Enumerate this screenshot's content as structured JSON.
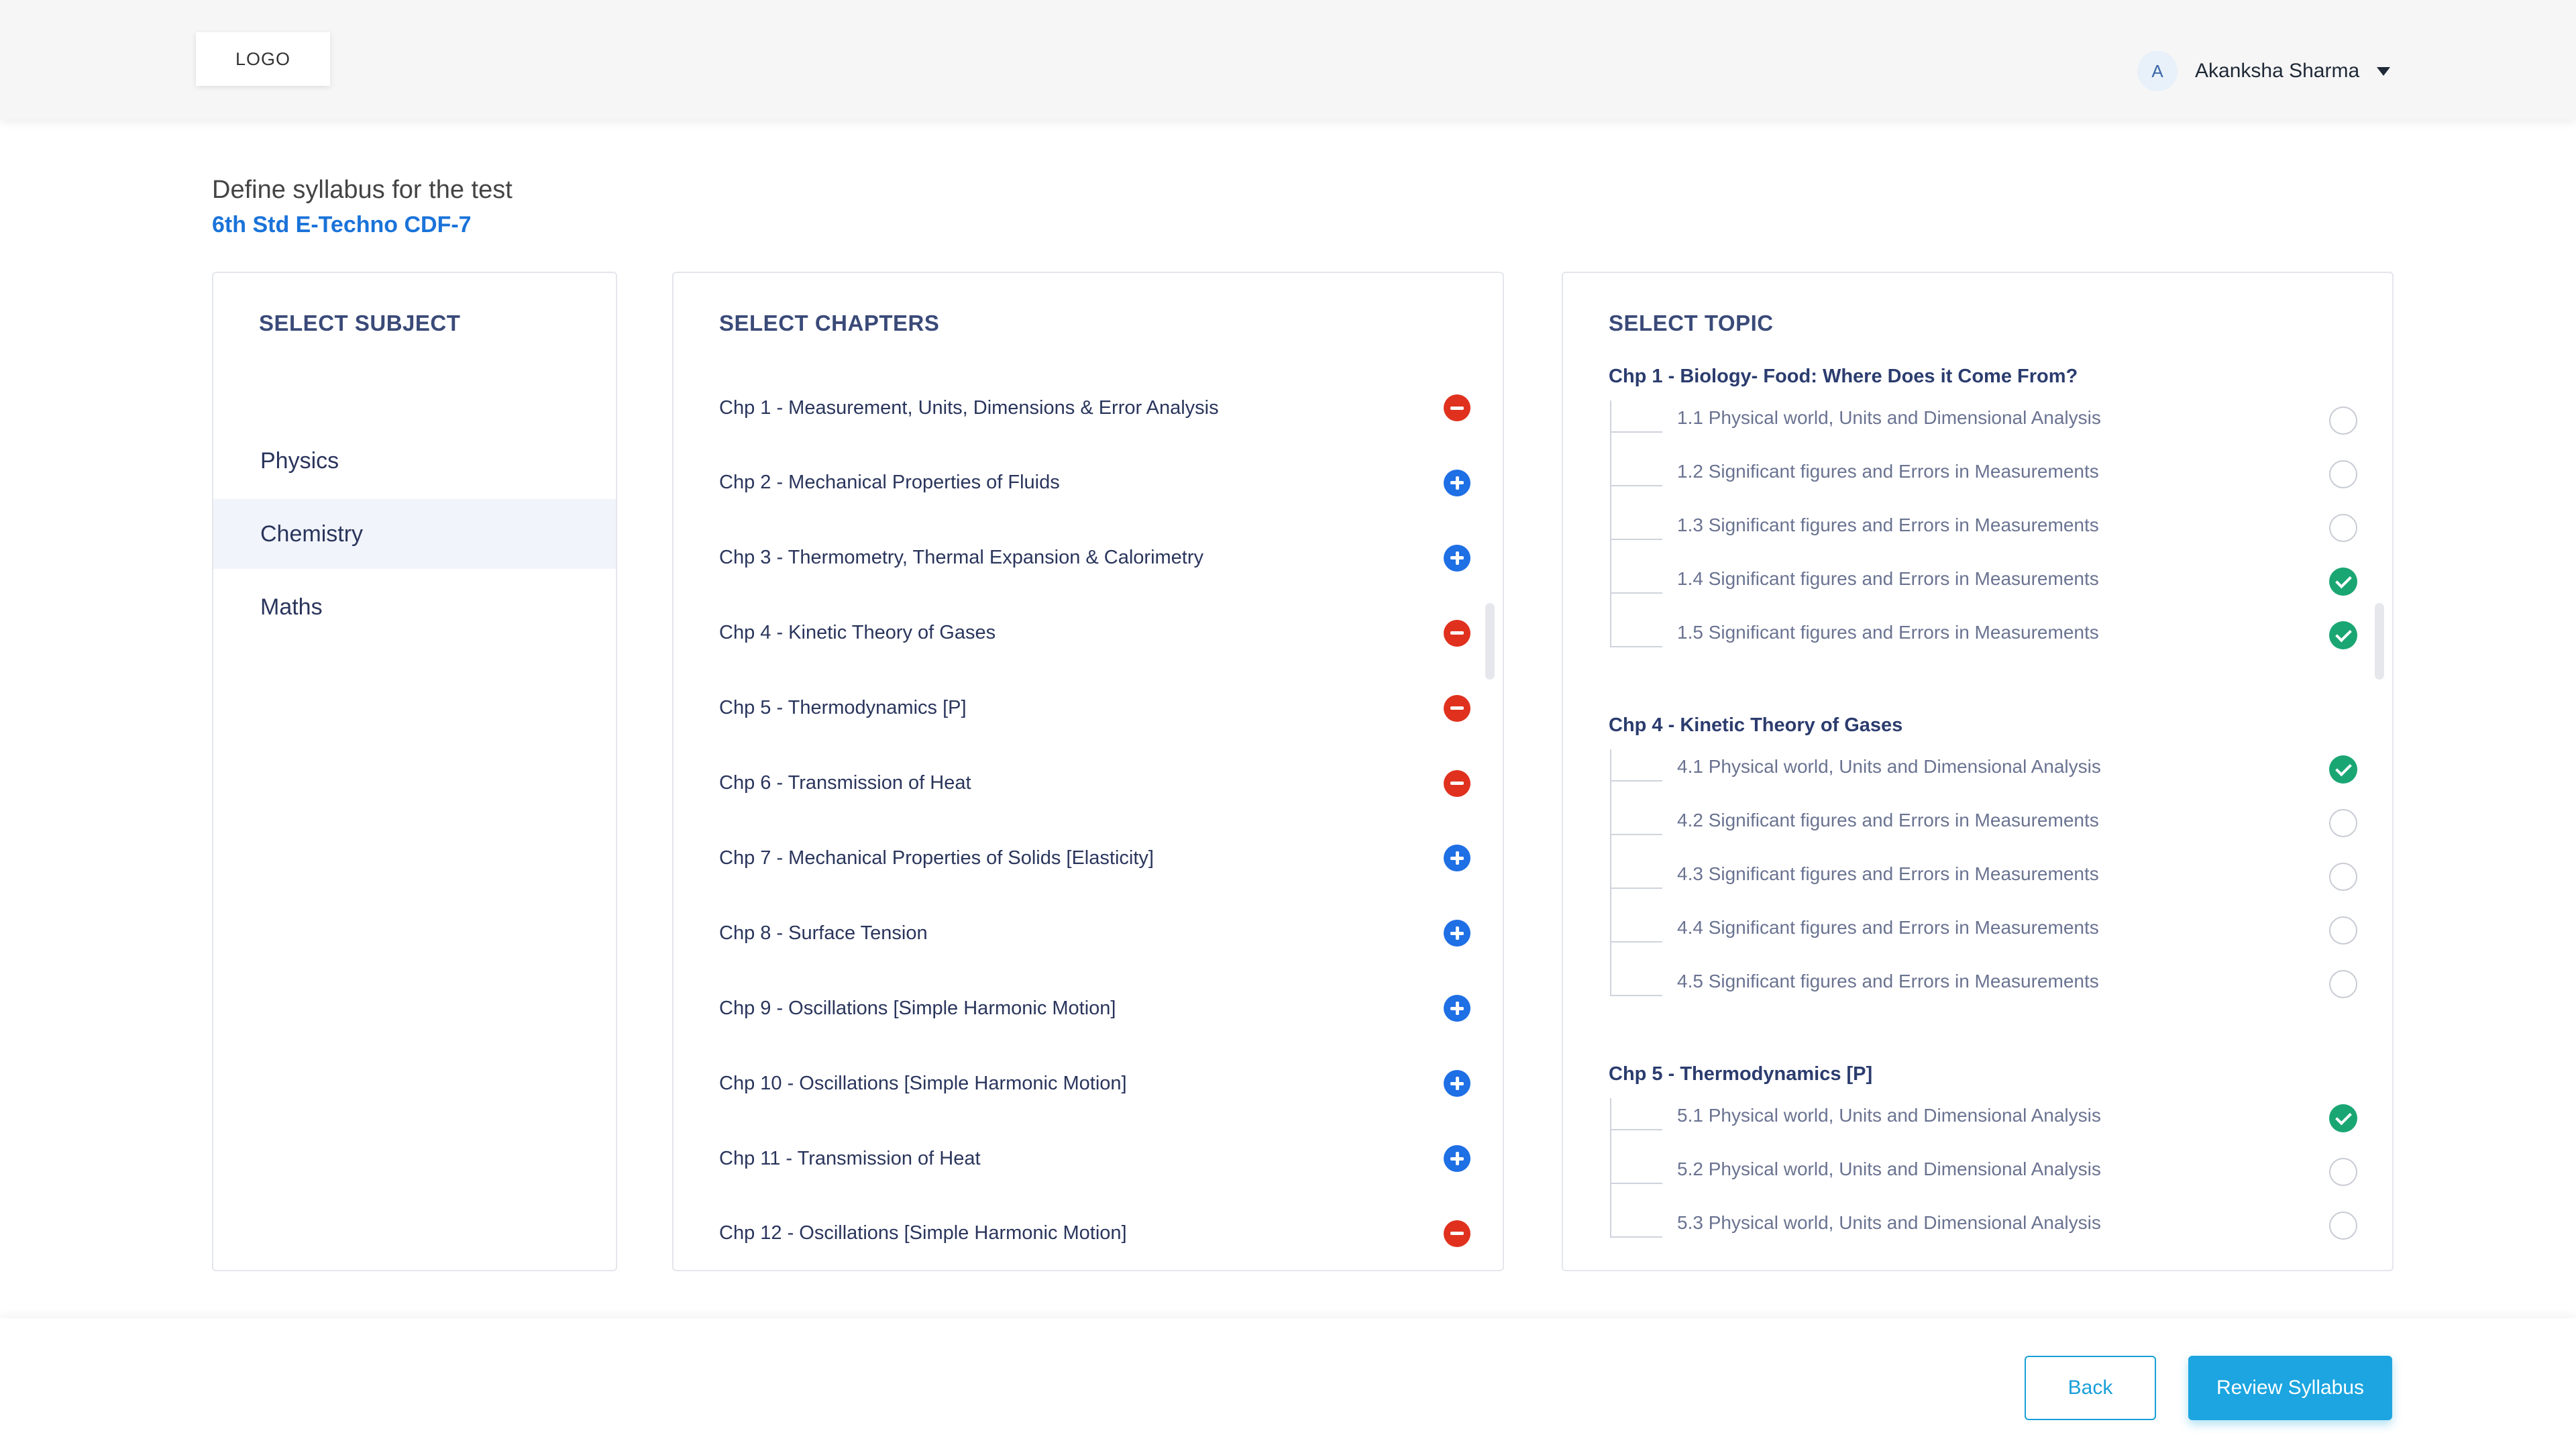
{
  "header": {
    "logo": "LOGO",
    "user": {
      "avatar_initial": "A",
      "name": "Akanksha Sharma"
    }
  },
  "page": {
    "title": "Define syllabus for the test",
    "test_name": "6th Std E-Techno CDF-7"
  },
  "subjects": {
    "title": "SELECT SUBJECT",
    "selected": "Chemistry",
    "items": [
      {
        "label": "Physics",
        "active": false
      },
      {
        "label": "Chemistry",
        "active": true
      },
      {
        "label": "Maths",
        "active": false
      }
    ]
  },
  "chapters": {
    "title": "SELECT CHAPTERS",
    "items": [
      {
        "label": "Chp 1 - Measurement, Units, Dimensions & Error Analysis",
        "state": "selected",
        "icon": "remove-icon"
      },
      {
        "label": "Chp 2 - Mechanical Properties of Fluids",
        "state": "unselected",
        "icon": "add-icon"
      },
      {
        "label": "Chp 3 - Thermometry, Thermal Expansion & Calorimetry",
        "state": "unselected",
        "icon": "add-icon"
      },
      {
        "label": "Chp 4 - Kinetic Theory of Gases",
        "state": "selected",
        "icon": "remove-icon"
      },
      {
        "label": "Chp 5 - Thermodynamics [P]",
        "state": "selected",
        "icon": "remove-icon"
      },
      {
        "label": "Chp 6 - Transmission of Heat",
        "state": "selected",
        "icon": "remove-icon"
      },
      {
        "label": "Chp 7 - Mechanical Properties of Solids [Elasticity]",
        "state": "unselected",
        "icon": "add-icon"
      },
      {
        "label": "Chp 8 - Surface Tension",
        "state": "unselected",
        "icon": "add-icon"
      },
      {
        "label": "Chp 9 - Oscillations [Simple Harmonic Motion]",
        "state": "unselected",
        "icon": "add-icon"
      },
      {
        "label": "Chp 10 - Oscillations [Simple Harmonic Motion]",
        "state": "unselected",
        "icon": "add-icon"
      },
      {
        "label": "Chp 11 - Transmission of Heat",
        "state": "unselected",
        "icon": "add-icon"
      },
      {
        "label": "Chp 12 - Oscillations [Simple Harmonic Motion]",
        "state": "selected",
        "icon": "remove-icon"
      }
    ]
  },
  "topics": {
    "title": "SELECT TOPIC",
    "groups": [
      {
        "chapter": "Chp 1 - Biology- Food: Where Does it Come From?",
        "items": [
          {
            "label": "1.1 Physical world, Units and Dimensional Analysis",
            "checked": false
          },
          {
            "label": "1.2 Significant figures and Errors in Measurements",
            "checked": false
          },
          {
            "label": "1.3 Significant figures and Errors in Measurements",
            "checked": false
          },
          {
            "label": "1.4 Significant figures and Errors in Measurements",
            "checked": true
          },
          {
            "label": "1.5 Significant figures and Errors in Measurements",
            "checked": true
          }
        ]
      },
      {
        "chapter": "Chp 4 - Kinetic Theory of Gases",
        "items": [
          {
            "label": "4.1 Physical world, Units and Dimensional Analysis",
            "checked": true
          },
          {
            "label": "4.2 Significant figures and Errors in Measurements",
            "checked": false
          },
          {
            "label": "4.3 Significant figures and Errors in Measurements",
            "checked": false
          },
          {
            "label": "4.4 Significant figures and Errors in Measurements",
            "checked": false
          },
          {
            "label": "4.5 Significant figures and Errors in Measurements",
            "checked": false
          }
        ]
      },
      {
        "chapter": "Chp 5 - Thermodynamics [P]",
        "items": [
          {
            "label": "5.1 Physical world, Units and Dimensional Analysis",
            "checked": true
          },
          {
            "label": "5.2 Physical world, Units and Dimensional Analysis",
            "checked": false
          },
          {
            "label": "5.3 Physical world, Units and Dimensional Analysis",
            "checked": false
          }
        ]
      }
    ]
  },
  "footer": {
    "back_label": "Back",
    "review_label": "Review Syllabus"
  },
  "colors": {
    "accent": "#1ca5e0",
    "link": "#1a73d9",
    "remove": "#e0311e",
    "add": "#1f6fe5",
    "checked": "#1aa673"
  }
}
